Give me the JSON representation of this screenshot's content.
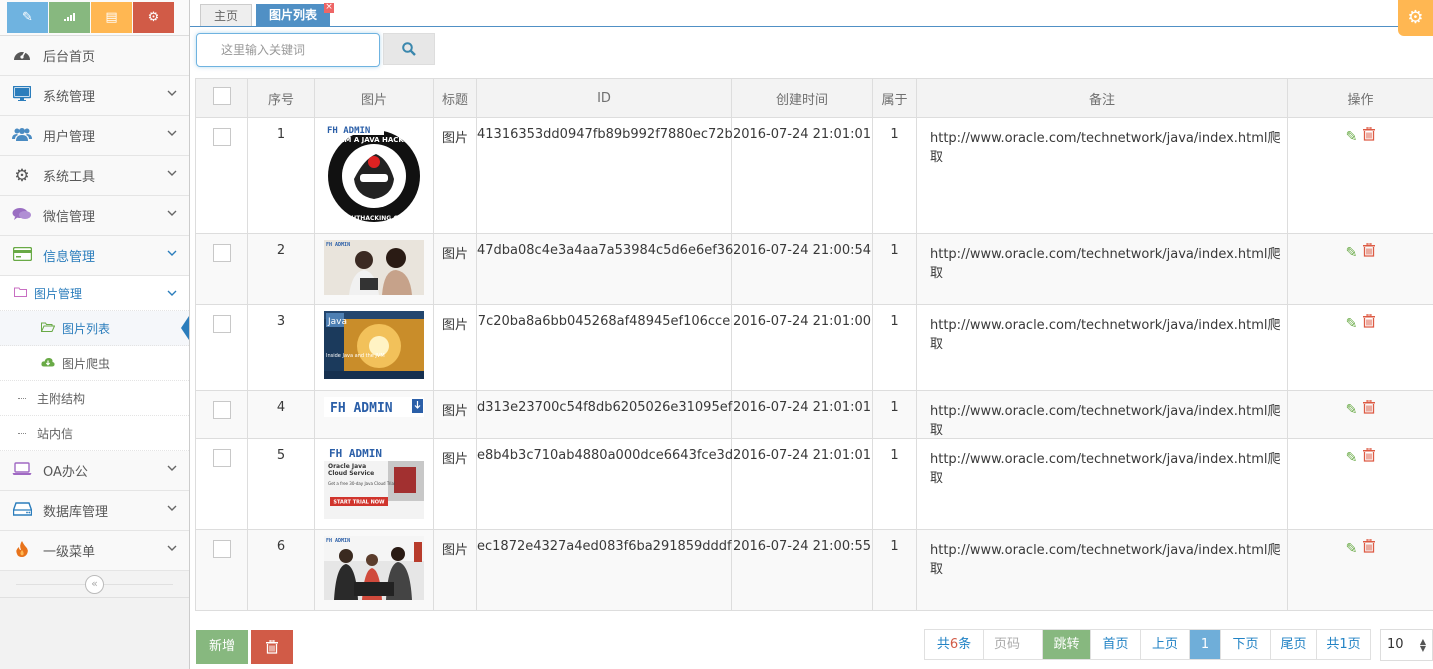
{
  "shortcuts": [
    "pencil-icon",
    "signal-icon",
    "book-icon",
    "cogs-icon"
  ],
  "shortcut_colors": [
    "#6fb3e0",
    "#87b87f",
    "#ffb752",
    "#d15b47"
  ],
  "sidebar": {
    "items": [
      {
        "label": "后台首页",
        "icon": "dashboard-icon"
      },
      {
        "label": "系统管理",
        "icon": "desktop-icon"
      },
      {
        "label": "用户管理",
        "icon": "users-icon"
      },
      {
        "label": "系统工具",
        "icon": "cog-icon"
      },
      {
        "label": "微信管理",
        "icon": "comments-icon"
      },
      {
        "label": "信息管理",
        "icon": "credit-card-icon"
      },
      {
        "label": "OA办公",
        "icon": "laptop-icon"
      },
      {
        "label": "数据库管理",
        "icon": "hdd-icon"
      },
      {
        "label": "一级菜单",
        "icon": "fire-icon"
      }
    ],
    "sub": {
      "group": "图片管理",
      "children": [
        "图片列表",
        "图片爬虫"
      ],
      "siblings": [
        "主附结构",
        "站内信"
      ]
    },
    "collapse": "«"
  },
  "tabs": {
    "home": "主页",
    "active": "图片列表",
    "close": "×"
  },
  "search": {
    "placeholder": "这里输入关键词",
    "button_icon": "search-icon"
  },
  "table": {
    "headers": [
      "序号",
      "图片",
      "标题",
      "ID",
      "创建时间",
      "属于",
      "备注",
      "操作"
    ],
    "rows": [
      {
        "no": "1",
        "title": "图片",
        "id": "41316353dd0947fb89b992f7880ec72b",
        "time": "2016-07-24 21:01:01",
        "belong": "1",
        "note": "http://www.oracle.com/technetwork/java/index.html爬取",
        "thumb_text": "FH ADMIN"
      },
      {
        "no": "2",
        "title": "图片",
        "id": "47dba08c4e3a4aa7a53984c5d6e6ef36",
        "time": "2016-07-24 21:00:54",
        "belong": "1",
        "note": "http://www.oracle.com/technetwork/java/index.html爬取",
        "thumb_text": "FH ADMIN"
      },
      {
        "no": "3",
        "title": "图片",
        "id": "7c20ba8a6bb045268af48945ef106cce",
        "time": "2016-07-24 21:01:00",
        "belong": "1",
        "note": "http://www.oracle.com/technetwork/java/index.html爬取",
        "thumb_text": "Inside Java and the JVM"
      },
      {
        "no": "4",
        "title": "图片",
        "id": "d313e23700c54f8db6205026e31095ef",
        "time": "2016-07-24 21:01:01",
        "belong": "1",
        "note": "http://www.oracle.com/technetwork/java/index.html爬取",
        "thumb_text": "FH ADMIN"
      },
      {
        "no": "5",
        "title": "图片",
        "id": "e8b4b3c710ab4880a000dce6643fce3d",
        "time": "2016-07-24 21:01:01",
        "belong": "1",
        "note": "http://www.oracle.com/technetwork/java/index.html爬取",
        "thumb_text": "FH ADMIN"
      },
      {
        "no": "6",
        "title": "图片",
        "id": "ec1872e4327a4ed083f6ba291859dddf",
        "time": "2016-07-24 21:00:55",
        "belong": "1",
        "note": "http://www.oracle.com/technetwork/java/index.html爬取",
        "thumb_text": "FH ADMIN"
      }
    ]
  },
  "thumb_texts": {
    "t1_top": "FH ADMIN",
    "t1_ring": "I AM A JAVA HACKER",
    "t1_bottom": "NIGHTHACKING.COM",
    "t3_logo": "Java",
    "t3_caption": "Inside Java and the JVM",
    "t5_a": "Oracle Java",
    "t5_b": "Cloud Service",
    "t5_c": "Get a free 30-day Java Cloud Trial",
    "t5_btn": "START TRIAL NOW"
  },
  "buttons": {
    "add": "新增",
    "delete_icon": "trash-icon"
  },
  "pager": {
    "total_prefix": "共",
    "total_count": "6",
    "total_suffix": "条",
    "page_input_placeholder": "页码",
    "jump": "跳转",
    "first": "首页",
    "prev": "上页",
    "current": "1",
    "next": "下页",
    "last": "尾页",
    "pages": "共1页",
    "page_size": "10"
  }
}
